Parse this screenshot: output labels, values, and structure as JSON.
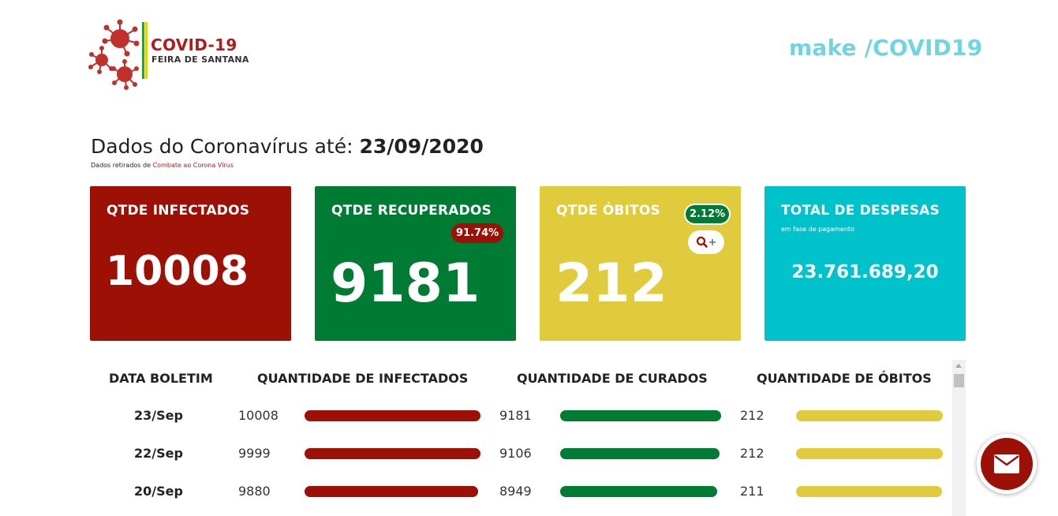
{
  "header": {
    "logo_title": "COVID-19",
    "logo_subtitle": "FEIRA DE SANTANA",
    "make_link": "make /COVID19"
  },
  "headline": {
    "prefix": "Dados do Coronavírus até: ",
    "date": "23/09/2020",
    "source_prefix": "Dados retirados de ",
    "source_link": "Combate ao Corona Vírus"
  },
  "cards": {
    "infectados": {
      "title": "QTDE INFECTADOS",
      "value": "10008"
    },
    "recuperados": {
      "title": "QTDE RECUPERADOS",
      "value": "9181",
      "percent": "91.74%"
    },
    "obitos": {
      "title": "QTDE ÓBITOS",
      "value": "212",
      "percent": "2.12%",
      "zoom_icon": "search-plus-icon"
    },
    "despesas": {
      "title": "TOTAL DE DESPESAS",
      "subtitle": "em fase de pagamento",
      "value": "23.761.689,20"
    }
  },
  "table": {
    "headers": [
      "DATA BOLETIM",
      "QUANTIDADE DE INFECTADOS",
      "QUANTIDADE DE CURADOS",
      "QUANTIDADE DE ÓBITOS"
    ],
    "rows": [
      {
        "date": "23/Sep",
        "infectados": "10008",
        "curados": "9181",
        "obitos": "212",
        "inf_fill": 1.0,
        "cur_fill": 1.0,
        "obi_fill": 1.0
      },
      {
        "date": "22/Sep",
        "infectados": "9999",
        "curados": "9106",
        "obitos": "212",
        "inf_fill": 0.999,
        "cur_fill": 0.992,
        "obi_fill": 1.0
      },
      {
        "date": "20/Sep",
        "infectados": "9880",
        "curados": "8949",
        "obitos": "211",
        "inf_fill": 0.987,
        "cur_fill": 0.975,
        "obi_fill": 0.995
      }
    ]
  },
  "colors": {
    "infectados": "#9c1006",
    "recuperados": "#007b33",
    "obitos": "#e0cb3d",
    "despesas": "#00c2cb"
  },
  "mail_button_icon": "envelope-icon"
}
